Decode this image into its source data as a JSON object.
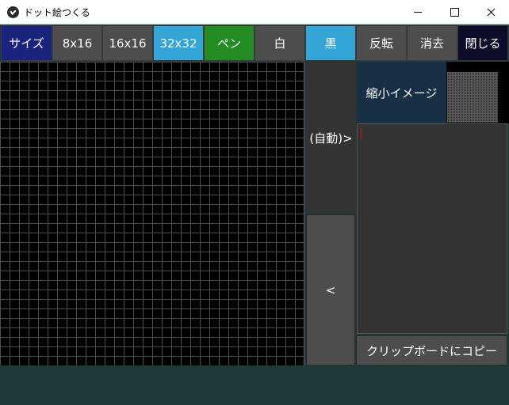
{
  "window": {
    "title": "ドット絵つくる",
    "icon": "app-logo-icon",
    "controls": [
      "minimize-icon",
      "maximize-icon",
      "close-icon"
    ]
  },
  "toolbar": {
    "size_label": "サイズ",
    "size_8": "8x16",
    "size_16": "16x16",
    "size_32": "32x32",
    "pen": "ペン",
    "white": "白",
    "black": "黒",
    "invert": "反転",
    "clear": "消去",
    "close": "閉じる",
    "selected_size": "32x32",
    "selected_color": "黒"
  },
  "side": {
    "auto_button": "(自動)>",
    "back_button": "<"
  },
  "thumbnail": {
    "label": "縮小イメージ"
  },
  "output": {
    "value": ""
  },
  "copy_button": "クリップボードにコピー",
  "colors": {
    "size_label_bg": "#1a237e",
    "gray_button": "#4d4d4d",
    "selected_blue": "#33a5d6",
    "pen_green": "#228b22",
    "close_bg": "#0d0d2b",
    "thumb_label_bg": "#173046",
    "background": "#1e3a38"
  }
}
